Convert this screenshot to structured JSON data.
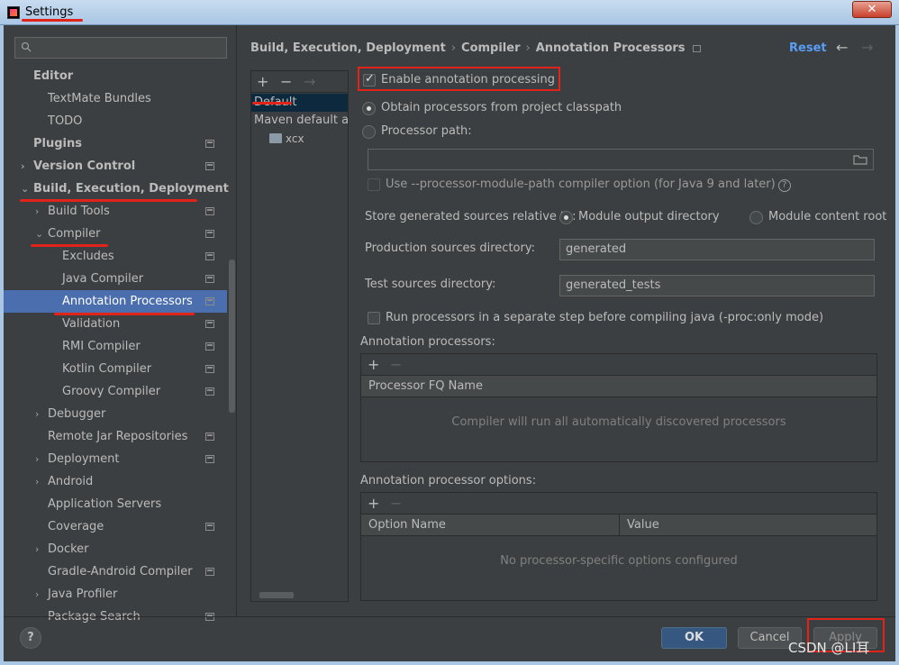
{
  "window": {
    "title": "Settings",
    "close": "✕"
  },
  "search": {
    "value": ""
  },
  "tree": [
    {
      "label": "Editor",
      "bold": true,
      "indent": 0,
      "chevron": "",
      "icon": false
    },
    {
      "label": "TextMate Bundles",
      "bold": false,
      "indent": 1,
      "chevron": "",
      "icon": false
    },
    {
      "label": "TODO",
      "bold": false,
      "indent": 1,
      "chevron": "",
      "icon": false
    },
    {
      "label": "Plugins",
      "bold": true,
      "indent": 0,
      "chevron": "",
      "icon": true
    },
    {
      "label": "Version Control",
      "bold": true,
      "indent": 0,
      "chevron": "›",
      "icon": true
    },
    {
      "label": "Build, Execution, Deployment",
      "bold": true,
      "indent": 0,
      "chevron": "⌄",
      "icon": false
    },
    {
      "label": "Build Tools",
      "bold": false,
      "indent": 1,
      "chevron": "›",
      "icon": true
    },
    {
      "label": "Compiler",
      "bold": false,
      "indent": 1,
      "chevron": "⌄",
      "icon": true
    },
    {
      "label": "Excludes",
      "bold": false,
      "indent": 2,
      "chevron": "",
      "icon": true
    },
    {
      "label": "Java Compiler",
      "bold": false,
      "indent": 2,
      "chevron": "",
      "icon": true
    },
    {
      "label": "Annotation Processors",
      "bold": false,
      "indent": 2,
      "chevron": "",
      "icon": true,
      "selected": true
    },
    {
      "label": "Validation",
      "bold": false,
      "indent": 2,
      "chevron": "",
      "icon": true
    },
    {
      "label": "RMI Compiler",
      "bold": false,
      "indent": 2,
      "chevron": "",
      "icon": true
    },
    {
      "label": "Kotlin Compiler",
      "bold": false,
      "indent": 2,
      "chevron": "",
      "icon": true
    },
    {
      "label": "Groovy Compiler",
      "bold": false,
      "indent": 2,
      "chevron": "",
      "icon": true
    },
    {
      "label": "Debugger",
      "bold": false,
      "indent": 1,
      "chevron": "›",
      "icon": false
    },
    {
      "label": "Remote Jar Repositories",
      "bold": false,
      "indent": 1,
      "chevron": "",
      "icon": true
    },
    {
      "label": "Deployment",
      "bold": false,
      "indent": 1,
      "chevron": "›",
      "icon": true
    },
    {
      "label": "Android",
      "bold": false,
      "indent": 1,
      "chevron": "›",
      "icon": false
    },
    {
      "label": "Application Servers",
      "bold": false,
      "indent": 1,
      "chevron": "",
      "icon": false
    },
    {
      "label": "Coverage",
      "bold": false,
      "indent": 1,
      "chevron": "",
      "icon": true
    },
    {
      "label": "Docker",
      "bold": false,
      "indent": 1,
      "chevron": "›",
      "icon": false
    },
    {
      "label": "Gradle-Android Compiler",
      "bold": false,
      "indent": 1,
      "chevron": "",
      "icon": true
    },
    {
      "label": "Java Profiler",
      "bold": false,
      "indent": 1,
      "chevron": "›",
      "icon": false
    },
    {
      "label": "Package Search",
      "bold": false,
      "indent": 1,
      "chevron": "",
      "icon": true
    }
  ],
  "breadcrumb": {
    "part1": "Build, Execution, Deployment",
    "part2": "Compiler",
    "part3": "Annotation Processors",
    "sep": "›"
  },
  "header": {
    "reset": "Reset",
    "back": "←",
    "forward": "→"
  },
  "profiles": {
    "add": "+",
    "remove": "−",
    "move": "→",
    "items": [
      "Default",
      "Maven default annotation processors profile",
      "xcx"
    ]
  },
  "settings": {
    "enable_processing": "Enable annotation processing",
    "obtain_classpath": "Obtain processors from project classpath",
    "processor_path": "Processor path:",
    "processor_path_value": "",
    "module_path_option": "Use --processor-module-path compiler option (for Java 9 and later)",
    "store_relative": "Store generated sources relative to:",
    "module_output": "Module output directory",
    "module_content": "Module content root",
    "production_label": "Production sources directory:",
    "production_value": "generated",
    "test_label": "Test sources directory:",
    "test_value": "generated_tests",
    "run_separate": "Run processors in a separate step before compiling java (-proc:only mode)"
  },
  "processors_table": {
    "title": "Annotation processors:",
    "add": "+",
    "remove": "−",
    "column": "Processor FQ Name",
    "empty": "Compiler will run all automatically discovered processors"
  },
  "options_table": {
    "title": "Annotation processor options:",
    "add": "+",
    "remove": "−",
    "col_name": "Option Name",
    "col_value": "Value",
    "empty": "No processor-specific options configured"
  },
  "footer": {
    "help": "?",
    "ok": "OK",
    "cancel": "Cancel",
    "apply": "Apply"
  },
  "watermark": "CSDN @LI耳",
  "colors": {
    "selection": "#4b6eaf",
    "link": "#589df6",
    "annotation": "#e2231a",
    "background": "#3c3f41"
  }
}
